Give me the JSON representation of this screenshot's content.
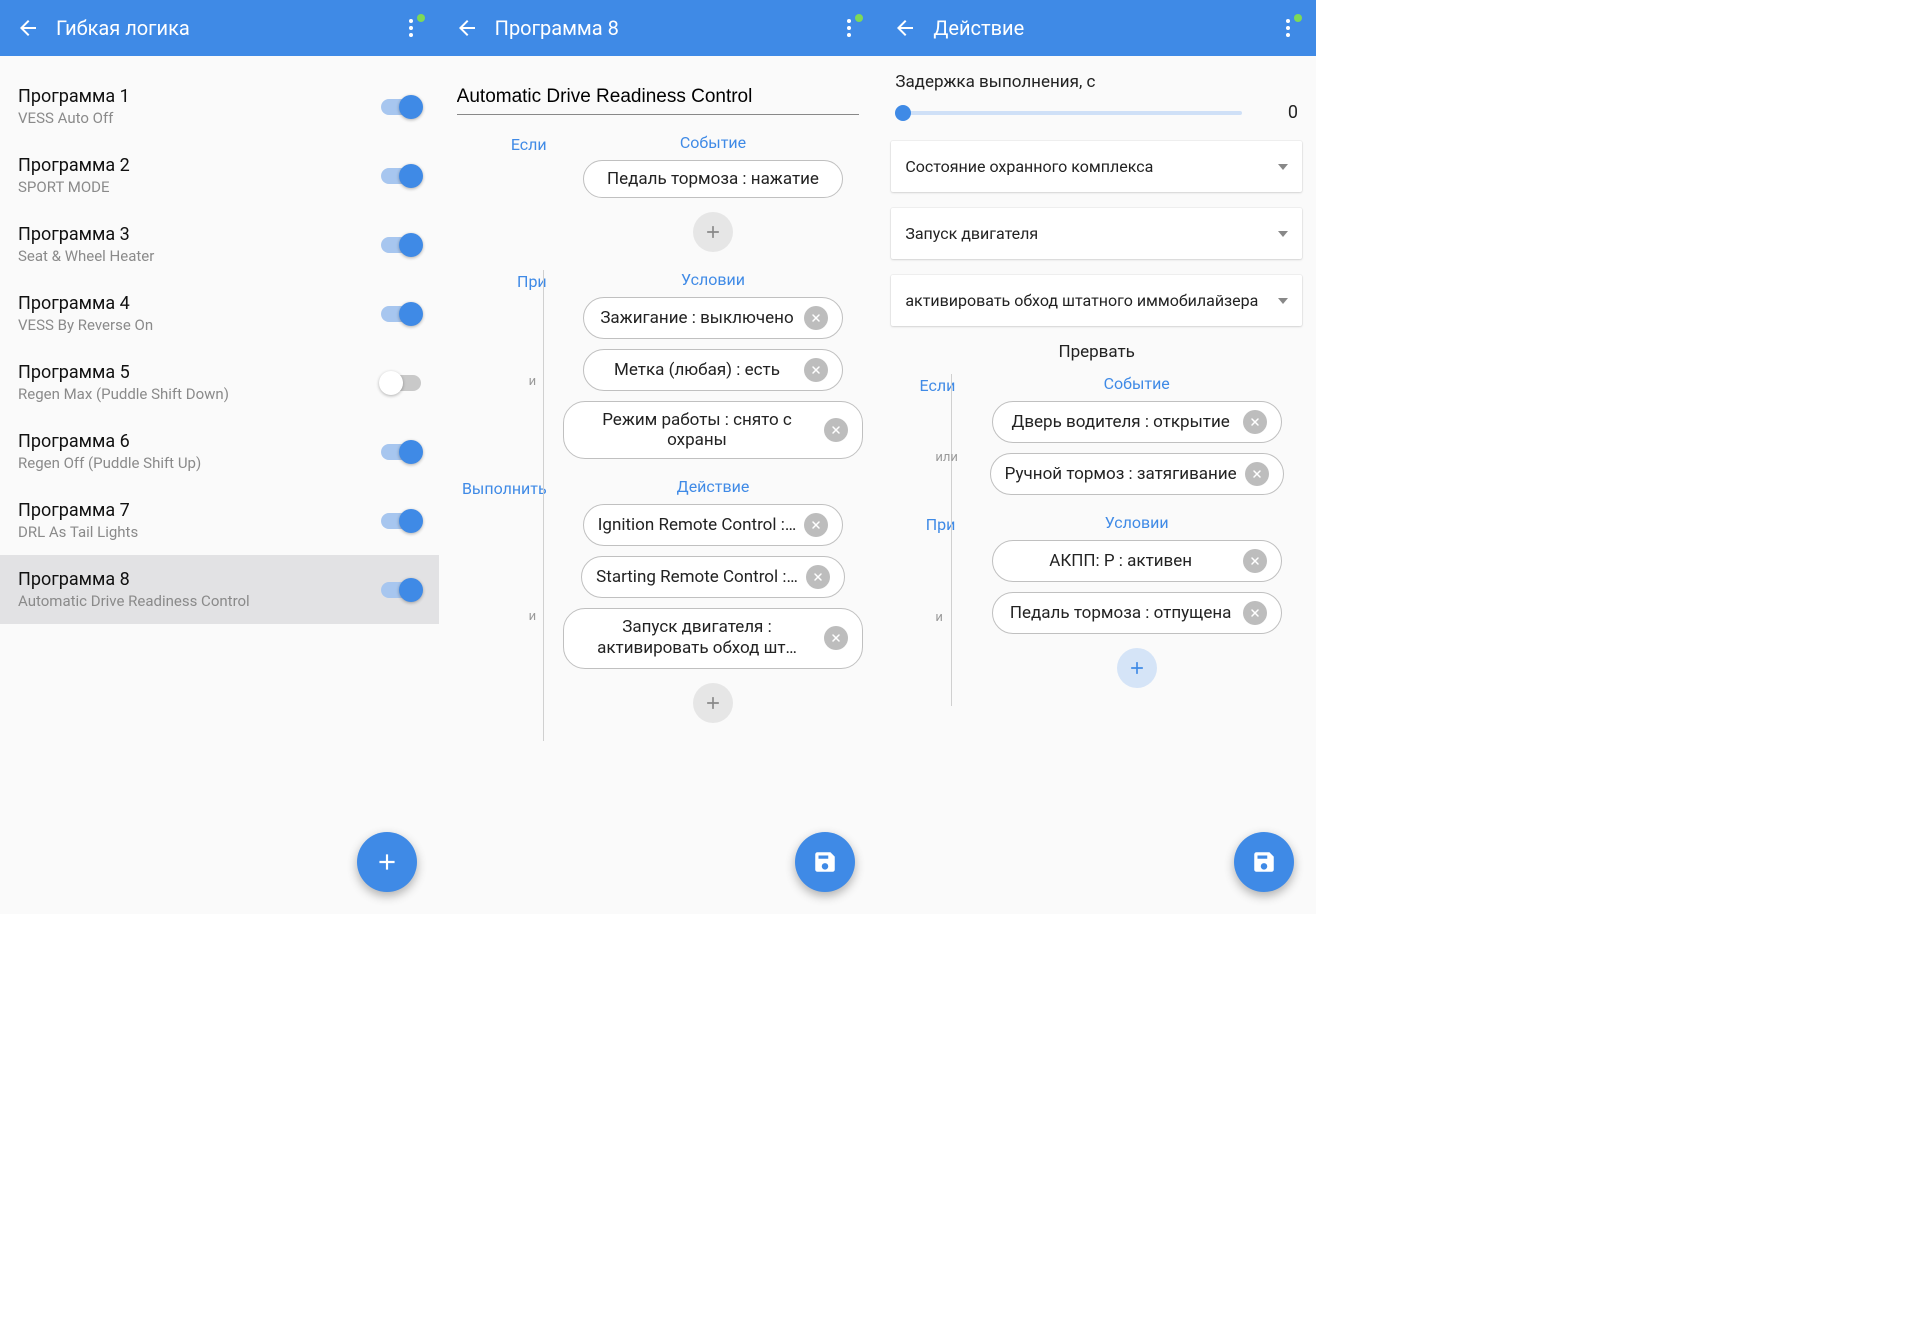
{
  "screen1": {
    "appbar_title": "Гибкая логика",
    "programs": [
      {
        "title": "Программа 1",
        "sub": "VESS Auto Off",
        "on": true
      },
      {
        "title": "Программа 2",
        "sub": "SPORT MODE",
        "on": true
      },
      {
        "title": "Программа 3",
        "sub": "Seat & Wheel Heater",
        "on": true
      },
      {
        "title": "Программа 4",
        "sub": "VESS By Reverse On",
        "on": true
      },
      {
        "title": "Программа 5",
        "sub": "Regen Max (Puddle Shift Down)",
        "on": false
      },
      {
        "title": "Программа 6",
        "sub": "Regen Off (Puddle Shift Up)",
        "on": true
      },
      {
        "title": "Программа 7",
        "sub": "DRL As Tail Lights",
        "on": true
      },
      {
        "title": "Программа 8",
        "sub": "Automatic Drive Readiness Control",
        "on": true,
        "selected": true
      }
    ]
  },
  "screen2": {
    "appbar_title": "Программа 8",
    "name_value": "Automatic Drive Readiness Control",
    "labels": {
      "if": "Если",
      "event": "Событие",
      "when": "При",
      "condition": "Условии",
      "execute": "Выполнить",
      "action": "Действие",
      "and": "и"
    },
    "event_chips": [
      "Педаль тормоза : нажатие"
    ],
    "condition_chips": [
      "Зажигание : выключено",
      "Метка (любая) : есть",
      "Режим работы : снято с охраны"
    ],
    "action_chips": [
      "Ignition Remote Control :…",
      "Starting Remote Control :…",
      "Запуск двигателя : активировать обход шт…"
    ]
  },
  "screen3": {
    "appbar_title": "Действие",
    "delay_label": "Задержка выполнения, с",
    "delay_value": "0",
    "dropdowns": [
      "Состояние охранного комплекса",
      "Запуск двигателя",
      "активировать обход штатного иммобилайзера"
    ],
    "interrupt_title": "Прервать",
    "labels": {
      "if": "Если",
      "event": "Событие",
      "when": "При",
      "condition": "Условии",
      "or": "или",
      "and": "и"
    },
    "event_chips": [
      "Дверь водителя : открытие",
      "Ручной тормоз : затягивание"
    ],
    "condition_chips": [
      "АКПП: P : активен",
      "Педаль тормоза : отпущена"
    ]
  }
}
